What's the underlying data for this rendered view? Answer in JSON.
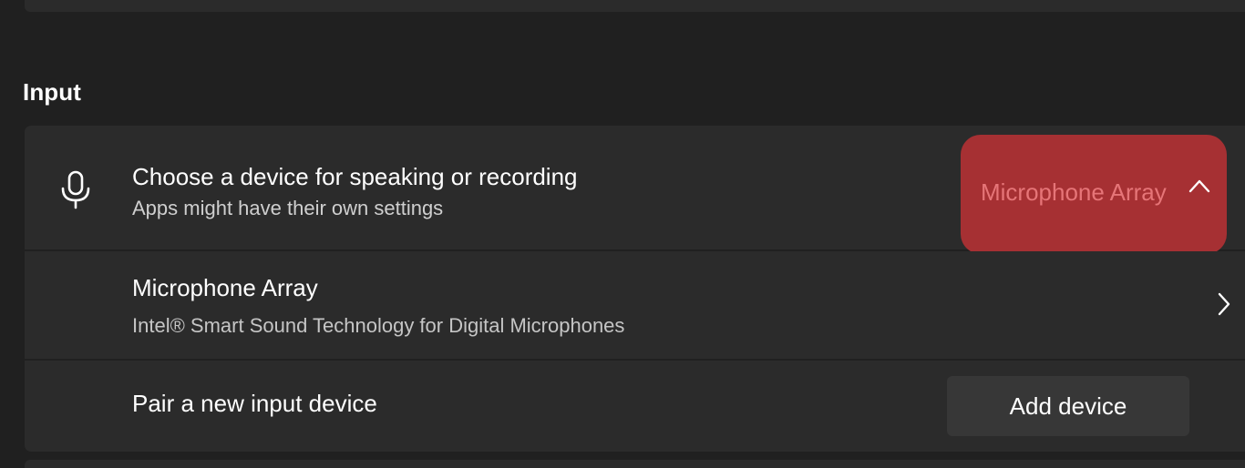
{
  "input_section": {
    "heading": "Input",
    "device_choice": {
      "title": "Choose a device for speaking or recording",
      "subtitle": "Apps might have their own settings",
      "selected_device": "Microphone Array",
      "icon": "microphone-icon",
      "expand_icon": "chevron-up-icon",
      "highlight_color": "#a63033"
    },
    "device": {
      "name": "Microphone Array",
      "description": "Intel® Smart Sound Technology for Digital Microphones",
      "icon": "chevron-right-icon"
    },
    "pair": {
      "label": "Pair a new input device",
      "button_label": "Add device"
    }
  }
}
